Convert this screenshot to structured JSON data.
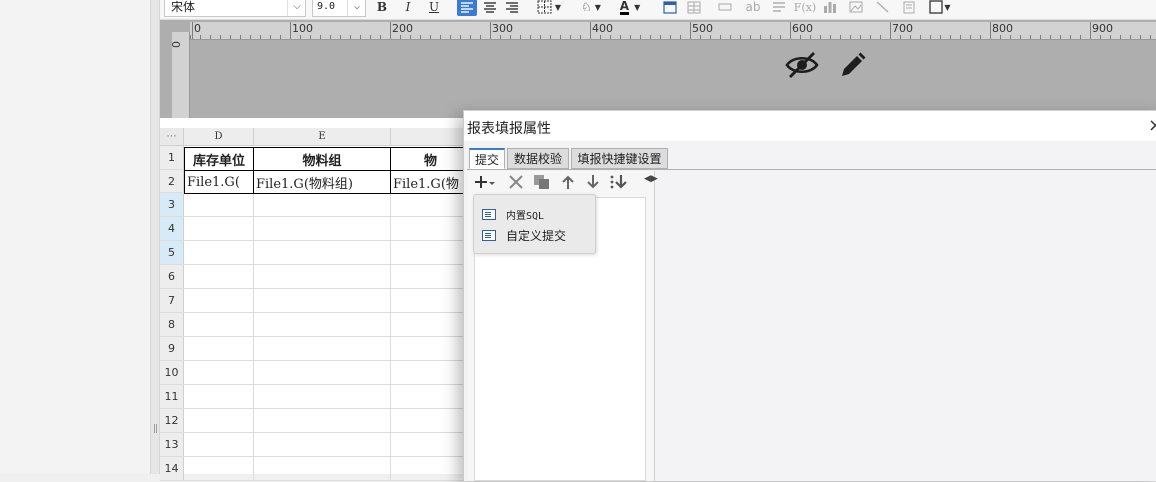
{
  "toolbar": {
    "font_name": "宋体",
    "font_size": "9.0",
    "bold_label": "B",
    "italic_label": "I",
    "underline_label": "U",
    "text_color_label": "A",
    "abc_label": "ab",
    "fx_label": "F(x)"
  },
  "ruler": {
    "labels": [
      "0",
      "100",
      "200",
      "300",
      "400",
      "500",
      "600",
      "700",
      "800",
      "900"
    ],
    "vertical_label": "0"
  },
  "sheet": {
    "columns": [
      "D",
      "E"
    ],
    "rows": [
      "1",
      "2",
      "3",
      "4",
      "5",
      "6",
      "7",
      "8",
      "9",
      "10",
      "11",
      "12",
      "13",
      "14"
    ],
    "header_cells": [
      "库存单位",
      "物料组",
      "物"
    ],
    "value_cells": [
      "File1.G(",
      "File1.G(物料组)",
      "File1.G(物"
    ]
  },
  "dialog": {
    "title": "报表填报属性",
    "close_glyph": "×",
    "tabs": [
      "提交",
      "数据校验",
      "填报快捷键设置"
    ],
    "menu_items": [
      "内置SQL",
      "自定义提交"
    ]
  },
  "icons": [
    "hide-icon",
    "edit-pencil-icon",
    "add-icon",
    "delete-icon",
    "copy-icon",
    "move-up-icon",
    "move-down-icon",
    "move-bottom-icon"
  ]
}
